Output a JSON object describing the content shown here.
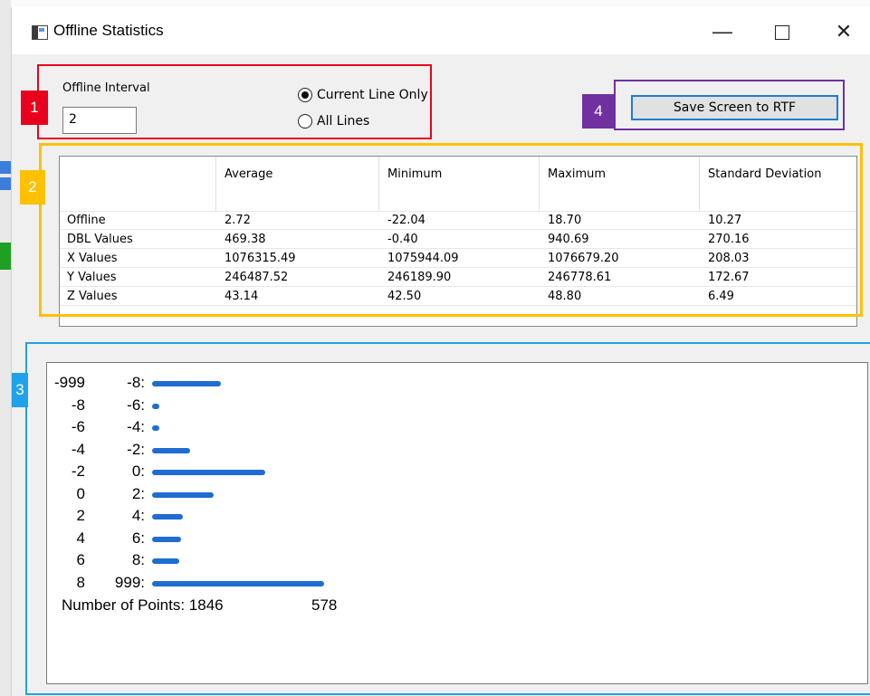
{
  "window": {
    "title": "Offline Statistics",
    "controls": {
      "minimize": "—",
      "maximize": "□",
      "close": "✕"
    }
  },
  "badges": {
    "b1": "1",
    "b2": "2",
    "b3": "3",
    "b4": "4"
  },
  "interval": {
    "label": "Offline Interval",
    "value": "2",
    "options": [
      {
        "label": "Current Line Only",
        "selected": true
      },
      {
        "label": "All Lines",
        "selected": false
      }
    ]
  },
  "save_button": {
    "label": "Save Screen to RTF"
  },
  "stats": {
    "headers": [
      "",
      "Average",
      "Minimum",
      "Maximum",
      "Standard Deviation"
    ],
    "rows": [
      {
        "name": "Offline",
        "average": "2.72",
        "minimum": "-22.04",
        "maximum": "18.70",
        "stddev": "10.27"
      },
      {
        "name": "DBL Values",
        "average": "469.38",
        "minimum": "-0.40",
        "maximum": "940.69",
        "stddev": "270.16"
      },
      {
        "name": "X Values",
        "average": "1076315.49",
        "minimum": "1075944.09",
        "maximum": "1076679.20",
        "stddev": "208.03"
      },
      {
        "name": "Y Values",
        "average": "246487.52",
        "minimum": "246189.90",
        "maximum": "246778.61",
        "stddev": "172.67"
      },
      {
        "name": "Z Values",
        "average": "43.14",
        "minimum": "42.50",
        "maximum": "48.80",
        "stddev": "6.49"
      }
    ]
  },
  "histogram": {
    "bins": [
      {
        "from": "-999",
        "to": "-8:",
        "relative": 0.4
      },
      {
        "from": "-8",
        "to": "-6:",
        "relative": 0.03
      },
      {
        "from": "-6",
        "to": "-4:",
        "relative": 0.03
      },
      {
        "from": "-4",
        "to": "-2:",
        "relative": 0.22
      },
      {
        "from": "-2",
        "to": "0:",
        "relative": 0.66
      },
      {
        "from": "0",
        "to": "2:",
        "relative": 0.36
      },
      {
        "from": "2",
        "to": "4:",
        "relative": 0.18
      },
      {
        "from": "4",
        "to": "6:",
        "relative": 0.17
      },
      {
        "from": "6",
        "to": "8:",
        "relative": 0.16
      },
      {
        "from": "8",
        "to": "999:",
        "relative": 1.0
      }
    ],
    "points_label": "Number of Points: 1846",
    "points_value": "578",
    "bar_color": "#1f6dd0"
  },
  "colors": {
    "highlight_red": "#e8001c",
    "highlight_orange": "#ffc000",
    "highlight_blue": "#1fa2ea",
    "highlight_purple": "#7030a0"
  }
}
